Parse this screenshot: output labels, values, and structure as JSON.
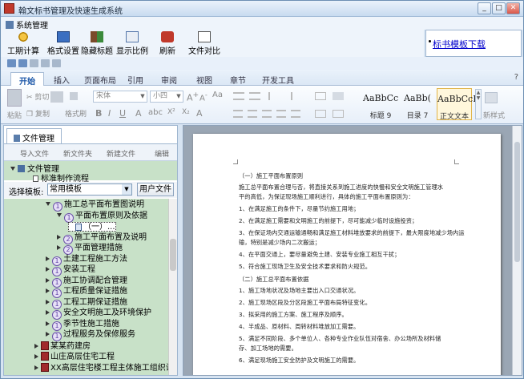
{
  "window": {
    "title": "翰文标书管理及快速生成系统"
  },
  "menu": {
    "system": "系统管理"
  },
  "toolbar": {
    "items": [
      {
        "label": "工期计算",
        "icon": "gear-icon"
      },
      {
        "label": "格式设置",
        "icon": "format-icon"
      },
      {
        "label": "隐藏标题",
        "icon": "hide-title-icon"
      },
      {
        "label": "显示比例",
        "icon": "zoom-icon"
      },
      {
        "label": "刷新",
        "icon": "refresh-icon"
      },
      {
        "label": "文件对比",
        "icon": "compare-icon"
      }
    ],
    "link": "标书模板下载"
  },
  "ribbon": {
    "tabs": [
      "开始",
      "插入",
      "页面布局",
      "引用",
      "审阅",
      "视图",
      "章节",
      "开发工具"
    ],
    "help": "?",
    "paste": "粘贴",
    "cut": "剪切",
    "copy": "复制",
    "format_painter": "格式刷",
    "font": "宋体",
    "size": "小四",
    "styles": [
      {
        "preview": "AaBbCc",
        "name": "标题 9"
      },
      {
        "preview": "AaBb(",
        "name": "目录 7"
      },
      {
        "preview": "AaBbCcI",
        "name": "正文文本"
      }
    ],
    "new_style": "新样式"
  },
  "left": {
    "tab": "文件管理",
    "actions": [
      "导入文件",
      "新文件夹",
      "新建文件",
      "编辑"
    ],
    "root": "文件管理",
    "root_child": "标准制作流程",
    "select_label": "选择模板:",
    "select_value": "常用模板",
    "user_file_button": "用户文件",
    "tree": [
      {
        "level": 2,
        "num": "1",
        "label": "施工总平面布置图说明",
        "open": true
      },
      {
        "level": 3,
        "num": "1",
        "label": "平面布置原则及依据",
        "open": true
      },
      {
        "level": 4,
        "num": "",
        "label": "（一）...",
        "open": false
      },
      {
        "level": 3,
        "num": "2",
        "label": "施工平面布置及说明",
        "open": false
      },
      {
        "level": 3,
        "num": "2",
        "label": "平面管理措施",
        "open": false
      },
      {
        "level": 2,
        "num": "1",
        "label": "土建工程施工方法",
        "open": false
      },
      {
        "level": 2,
        "num": "1",
        "label": "安装工程",
        "open": false
      },
      {
        "level": 2,
        "num": "1",
        "label": "施工协调配合管理",
        "open": false
      },
      {
        "level": 2,
        "num": "1",
        "label": "工程质量保证措施",
        "open": false
      },
      {
        "level": 2,
        "num": "1",
        "label": "工程工期保证措施",
        "open": false
      },
      {
        "level": 2,
        "num": "1",
        "label": "安全文明施工及环境保护",
        "open": false
      },
      {
        "level": 2,
        "num": "1",
        "label": "季节性施工措施",
        "open": false
      },
      {
        "level": 2,
        "num": "1",
        "label": "过程服务及保修服务",
        "open": false
      },
      {
        "level": 1,
        "num": "",
        "label": "某某药建房",
        "open": false
      },
      {
        "level": 1,
        "num": "",
        "label": "山庄高层住宅工程",
        "open": false
      },
      {
        "level": 1,
        "num": "",
        "label": "XX高层住宅楼工程主体施工组织设计",
        "open": false
      }
    ]
  },
  "document": {
    "lines": [
      "（一）施工平面布置原则",
      "施工总平面布置合理与否，将直接关系到施工进度的快慢和安全文明施工管理水",
      "平的高低，为保证现场施工顺利进行，具体的施工平面布置原则为：",
      "1、在满足施工的条件下，尽量节约施工用地；",
      "2、在满足施工需要和文明施工的前提下，尽可能减少临时设施投资；",
      "3、在保证场内交通运输通畅和满足施工材料堆放要求的前提下，最大限度地减少场内运",
      "输，特别是减少场内二次搬运；",
      "4、在平面交通上，要尽量避免土建、安装专业施工相互干扰；",
      "5、符合施工现场卫生及安全技术要求和防火规范。",
      "（二）施工总平面布置依据",
      "1、施工场地状况及场地主要出入口交通状况。",
      "2、施工现场区段及分区段施工平面布局特征变化。",
      "3、拟采用的施工方案、施工程序及顺序。",
      "4、半成品、原材料、周转材料堆放加工需要。",
      "5、满足不同阶段、多个单位人、各种专业作业队伍对宿舍、办公场所及材料储",
      "存、加工场地的需要。",
      "6、满足现场施工安全防护及文明施工的需要。"
    ]
  }
}
